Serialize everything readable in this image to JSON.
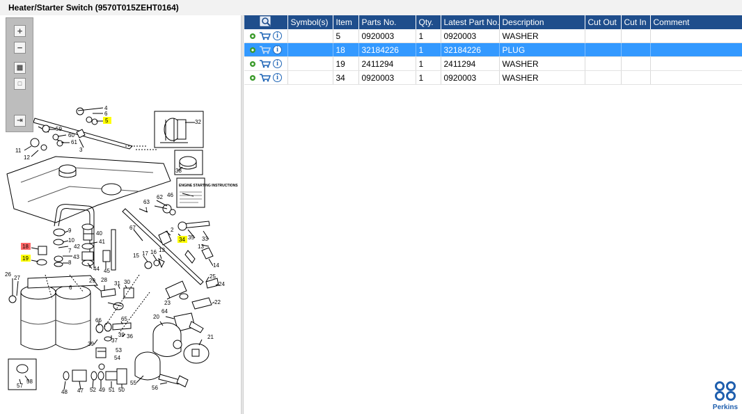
{
  "window": {
    "title": "Heater/Starter Switch (9570T015ZEHT0164)"
  },
  "toolbar": {
    "buttons": [
      "zoom-in-icon",
      "zoom-out-icon",
      "fit-icon",
      "actual-size-icon",
      "export-icon"
    ]
  },
  "diagram": {
    "callouts": {
      "c4": "4",
      "c6": "6",
      "c5": "5",
      "c59": "59",
      "c60": "60",
      "c61": "61",
      "c11": "11",
      "c12": "12",
      "c3": "3",
      "c32": "32",
      "c38": "38",
      "c46": "46",
      "c63": "63",
      "c62": "62",
      "c1": "1",
      "c67": "67",
      "c2": "2",
      "c34": "34",
      "c35": "35",
      "c33": "33",
      "c40": "40",
      "c9": "9",
      "c10": "10",
      "c41": "41",
      "c18": "18",
      "c42": "42",
      "c7": "7",
      "c19": "19",
      "c43": "43",
      "c8": "8",
      "c44": "44",
      "c45": "45",
      "c17": "17",
      "c16": "16",
      "c15": "15",
      "c13a": "13",
      "c13b": "13",
      "c14": "14",
      "c26": "26",
      "c27": "27",
      "c29": "29",
      "c28": "28",
      "c31": "31",
      "c30": "30",
      "c25": "25",
      "c24": "24",
      "c22": "22",
      "c23": "23",
      "c64": "64",
      "c66": "66",
      "c65": "65",
      "c20": "20",
      "c39a": "39",
      "c39b": "39",
      "c37": "37",
      "c36": "36",
      "c21": "21",
      "c53": "53",
      "c54": "54",
      "c58": "58",
      "c57": "57",
      "c48": "48",
      "c47": "47",
      "c52": "52",
      "c49": "49",
      "c51": "51",
      "c50": "50",
      "c55": "55",
      "c56": "56",
      "c6b": "6"
    },
    "instruction_label": "ENGINE STARTING INSTRUCTIONS"
  },
  "table": {
    "columns": [
      "Symbol(s)",
      "Item",
      "Parts No.",
      "Qty.",
      "Latest Part No.",
      "Description",
      "Cut Out",
      "Cut In",
      "Comment"
    ],
    "rows": [
      {
        "symbols": "",
        "item": "5",
        "parts_no": "0920003",
        "qty": "1",
        "latest": "0920003",
        "description": "WASHER",
        "cut_out": "",
        "cut_in": "",
        "comment": ""
      },
      {
        "symbols": "",
        "item": "18",
        "parts_no": "32184226",
        "qty": "1",
        "latest": "32184226",
        "description": "PLUG",
        "cut_out": "",
        "cut_in": "",
        "comment": ""
      },
      {
        "symbols": "",
        "item": "19",
        "parts_no": "2411294",
        "qty": "1",
        "latest": "2411294",
        "description": "WASHER",
        "cut_out": "",
        "cut_in": "",
        "comment": ""
      },
      {
        "symbols": "",
        "item": "34",
        "parts_no": "0920003",
        "qty": "1",
        "latest": "0920003",
        "description": "WASHER",
        "cut_out": "",
        "cut_in": "",
        "comment": ""
      }
    ],
    "selected_row": 1
  },
  "brand": {
    "logo_text": "Perkins"
  },
  "colors": {
    "header": "#1f4e8c",
    "selection": "#3399ff",
    "highlight_yellow": "#ffff00",
    "highlight_red": "#ff6666"
  }
}
